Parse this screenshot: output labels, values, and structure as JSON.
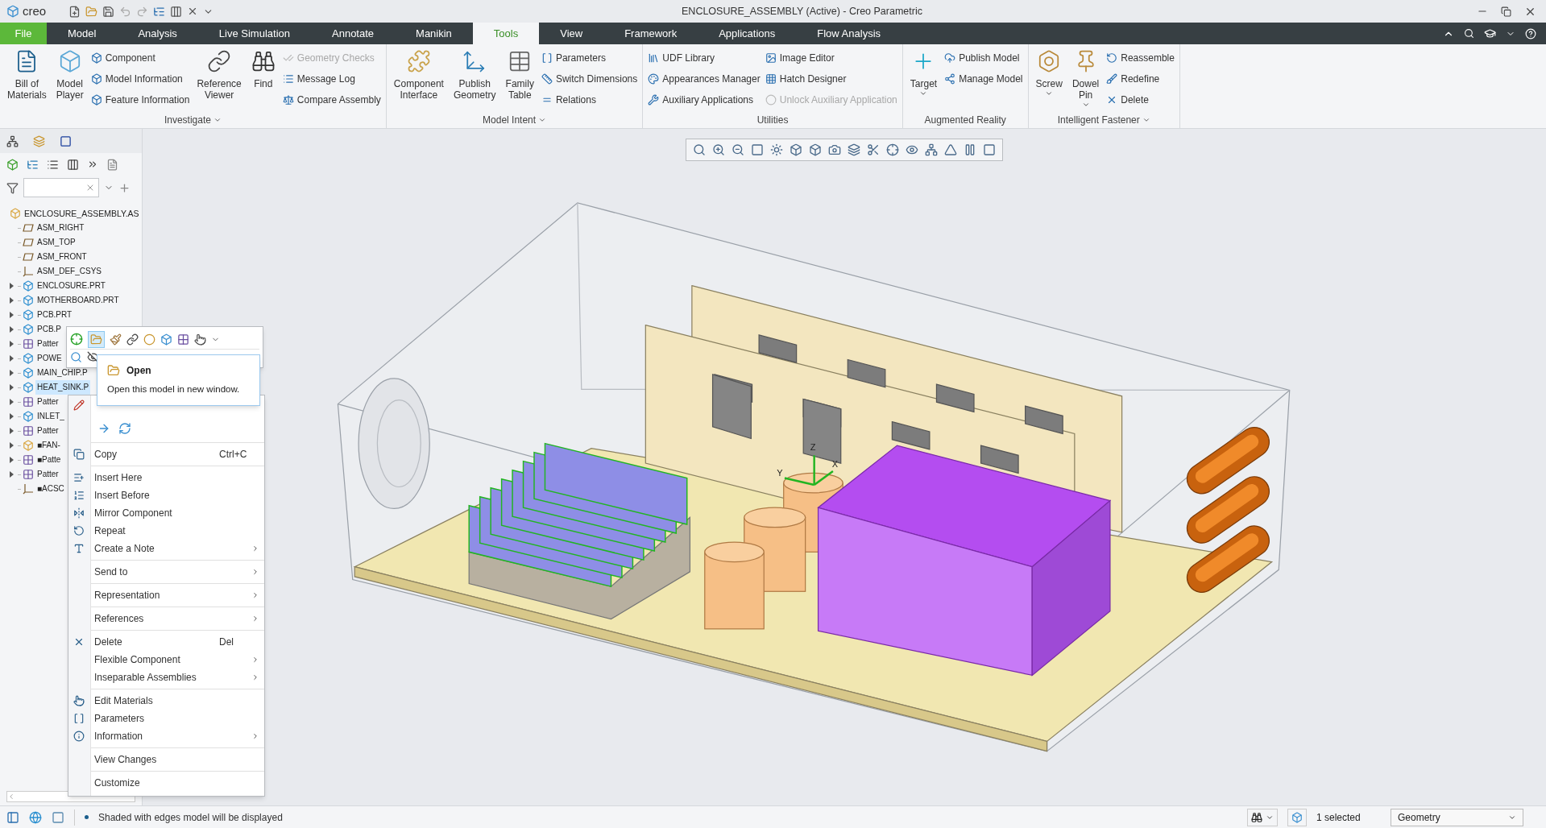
{
  "app": {
    "logo": "creo",
    "title": "ENCLOSURE_ASSEMBLY (Active) - Creo Parametric"
  },
  "tabs": [
    {
      "label": "File",
      "kind": "file",
      "selected": false
    },
    {
      "label": "Model",
      "kind": "tab",
      "selected": false
    },
    {
      "label": "Analysis",
      "kind": "tab",
      "selected": false
    },
    {
      "label": "Live Simulation",
      "kind": "tab",
      "selected": false
    },
    {
      "label": "Annotate",
      "kind": "tab",
      "selected": false
    },
    {
      "label": "Manikin",
      "kind": "tab",
      "selected": false
    },
    {
      "label": "Tools",
      "kind": "tab",
      "selected": true
    },
    {
      "label": "View",
      "kind": "tab",
      "selected": false
    },
    {
      "label": "Framework",
      "kind": "tab",
      "selected": false
    },
    {
      "label": "Applications",
      "kind": "tab",
      "selected": false
    },
    {
      "label": "Flow Analysis",
      "kind": "tab",
      "selected": false
    }
  ],
  "ribbon": [
    {
      "title": "Investigate",
      "menu": true,
      "columns": [
        {
          "kind": "large",
          "label": "Bill of\nMaterials",
          "caret": false
        },
        {
          "kind": "large",
          "label": "Model\nPlayer",
          "caret": false
        },
        {
          "kind": "stack",
          "items": [
            {
              "label": "Component",
              "disabled": false
            },
            {
              "label": "Model Information",
              "disabled": false
            },
            {
              "label": "Feature Information",
              "disabled": false
            }
          ]
        },
        {
          "kind": "large",
          "label": "Reference\nViewer",
          "caret": false
        },
        {
          "kind": "large",
          "label": "Find",
          "caret": false
        },
        {
          "kind": "stack",
          "items": [
            {
              "label": "Geometry Checks",
              "disabled": true
            },
            {
              "label": "Message Log",
              "disabled": false
            },
            {
              "label": "Compare Assembly",
              "disabled": false
            }
          ]
        }
      ]
    },
    {
      "title": "Model Intent",
      "menu": true,
      "columns": [
        {
          "kind": "large",
          "label": "Component\nInterface",
          "caret": false
        },
        {
          "kind": "large",
          "label": "Publish\nGeometry",
          "caret": false
        },
        {
          "kind": "large",
          "label": "Family\nTable",
          "caret": false
        },
        {
          "kind": "stack",
          "items": [
            {
              "label": "Parameters",
              "disabled": false
            },
            {
              "label": "Switch Dimensions",
              "disabled": false
            },
            {
              "label": "Relations",
              "disabled": false
            }
          ]
        }
      ]
    },
    {
      "title": "Utilities",
      "menu": false,
      "columns": [
        {
          "kind": "stack",
          "items": [
            {
              "label": "UDF Library",
              "disabled": false
            },
            {
              "label": "Appearances Manager",
              "disabled": false
            },
            {
              "label": "Auxiliary Applications",
              "disabled": false
            }
          ]
        },
        {
          "kind": "stack",
          "items": [
            {
              "label": "Image Editor",
              "disabled": false
            },
            {
              "label": "Hatch Designer",
              "disabled": false
            },
            {
              "label": "Unlock Auxiliary Application",
              "disabled": true
            }
          ]
        }
      ]
    },
    {
      "title": "Augmented Reality",
      "menu": false,
      "columns": [
        {
          "kind": "large",
          "label": "Target",
          "caret": true
        },
        {
          "kind": "stack",
          "items": [
            {
              "label": "Publish Model",
              "disabled": false
            },
            {
              "label": "Manage Model",
              "disabled": false
            }
          ]
        }
      ]
    },
    {
      "title": "Intelligent Fastener",
      "menu": true,
      "columns": [
        {
          "kind": "large",
          "label": "Screw",
          "caret": true
        },
        {
          "kind": "large",
          "label": "Dowel\nPin",
          "caret": true
        },
        {
          "kind": "stack",
          "items": [
            {
              "label": "Reassemble",
              "disabled": false
            },
            {
              "label": "Redefine",
              "disabled": false
            },
            {
              "label": "Delete",
              "disabled": false
            }
          ]
        }
      ]
    }
  ],
  "tree": {
    "label": "ENCLOSURE_ASSEMBLY.AS",
    "kind": "assembly",
    "selected": false,
    "children": [
      {
        "label": "ASM_RIGHT",
        "kind": "plane",
        "expandable": false,
        "selected": false
      },
      {
        "label": "ASM_TOP",
        "kind": "plane",
        "expandable": false,
        "selected": false
      },
      {
        "label": "ASM_FRONT",
        "kind": "plane",
        "expandable": false,
        "selected": false
      },
      {
        "label": "ASM_DEF_CSYS",
        "kind": "csys",
        "expandable": false,
        "selected": false
      },
      {
        "label": "ENCLOSURE.PRT",
        "kind": "part",
        "expandable": true,
        "selected": false
      },
      {
        "label": "MOTHERBOARD.PRT",
        "kind": "part",
        "expandable": true,
        "selected": false
      },
      {
        "label": "PCB.PRT",
        "kind": "part",
        "expandable": true,
        "selected": false
      },
      {
        "label": "PCB.P",
        "kind": "part",
        "expandable": true,
        "selected": false
      },
      {
        "label": "Patter",
        "kind": "pattern",
        "expandable": true,
        "selected": false
      },
      {
        "label": "POWE",
        "kind": "part",
        "expandable": true,
        "selected": false
      },
      {
        "label": "MAIN_CHIP.P",
        "kind": "part",
        "expandable": true,
        "selected": false
      },
      {
        "label": "HEAT_SINK.P",
        "kind": "part",
        "expandable": true,
        "selected": true
      },
      {
        "label": "Patter",
        "kind": "pattern",
        "expandable": true,
        "selected": false
      },
      {
        "label": "INLET_",
        "kind": "part",
        "expandable": true,
        "selected": false
      },
      {
        "label": "Patter",
        "kind": "pattern",
        "expandable": true,
        "selected": false
      },
      {
        "label": "■FAN-",
        "kind": "assembly",
        "expandable": true,
        "selected": false
      },
      {
        "label": "■Patte",
        "kind": "pattern",
        "expandable": true,
        "selected": false
      },
      {
        "label": "Patter",
        "kind": "pattern",
        "expandable": true,
        "selected": false
      },
      {
        "label": "■ACSC",
        "kind": "csys",
        "expandable": false,
        "selected": false
      }
    ]
  },
  "tooltip": {
    "title": "Open",
    "text": "Open this model in new window."
  },
  "context_menu": [
    [
      {
        "label": "Copy",
        "shortcut": "Ctrl+C",
        "submenu": false
      }
    ],
    [
      {
        "label": "Insert Here",
        "submenu": false
      },
      {
        "label": "Insert Before",
        "submenu": false
      },
      {
        "label": "Mirror Component",
        "submenu": false
      },
      {
        "label": "Repeat",
        "submenu": false
      },
      {
        "label": "Create a Note",
        "submenu": true
      }
    ],
    [
      {
        "label": "Send to",
        "submenu": true
      }
    ],
    [
      {
        "label": "Representation",
        "submenu": true
      }
    ],
    [
      {
        "label": "References",
        "submenu": true
      }
    ],
    [
      {
        "label": "Delete",
        "shortcut": "Del",
        "submenu": false
      },
      {
        "label": "Flexible Component",
        "submenu": true
      },
      {
        "label": "Inseparable Assemblies",
        "submenu": true
      }
    ],
    [
      {
        "label": "Edit Materials",
        "submenu": false
      },
      {
        "label": "Parameters",
        "submenu": false
      },
      {
        "label": "Information",
        "submenu": true
      }
    ],
    [
      {
        "label": "View Changes",
        "submenu": false
      }
    ],
    [
      {
        "label": "Customize",
        "submenu": false
      }
    ]
  ],
  "viewport": {
    "axis_labels": [
      "Z",
      "Y",
      "X"
    ]
  },
  "status_bar": {
    "message": "Shaded with edges model will be displayed",
    "selection": "1 selected",
    "filter": "Geometry"
  }
}
